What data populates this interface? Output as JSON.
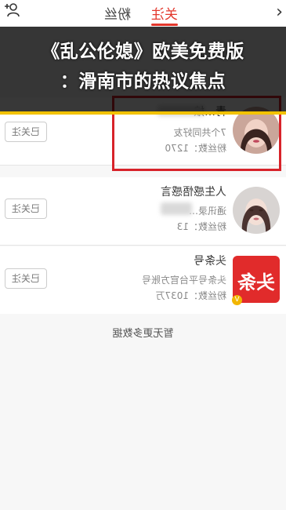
{
  "header": {
    "tabs": [
      {
        "label": "关注",
        "active": true
      },
      {
        "label": "粉丝",
        "active": false
      }
    ],
    "back_icon": "chevron-left-icon",
    "add_user_icon": "add-user-icon"
  },
  "banner": {
    "line1": "《乱公伦媳》欧美免费版",
    "line2": "：滑南市的热议焦点"
  },
  "users": [
    {
      "name": "青…娘",
      "line2": "7个共同好友",
      "line3": "粉丝数：1270",
      "follow_label": "已关注",
      "highlighted": true
    },
    {
      "name": "人生感悟感言",
      "line2": "通讯录…",
      "line3": "粉丝数：13",
      "follow_label": "已关注",
      "highlighted": false
    },
    {
      "name": "头条号",
      "line2": "头条号平台官方账号",
      "line3": "粉丝数：1037万",
      "follow_label": "已关注",
      "highlighted": false,
      "avatar_text": "头条",
      "verified": "V"
    }
  ],
  "footer_text": "暂无更多数据",
  "colors": {
    "accent": "#e3372c",
    "highlight": "#d8232a",
    "banner_bar": "#f2c200"
  }
}
